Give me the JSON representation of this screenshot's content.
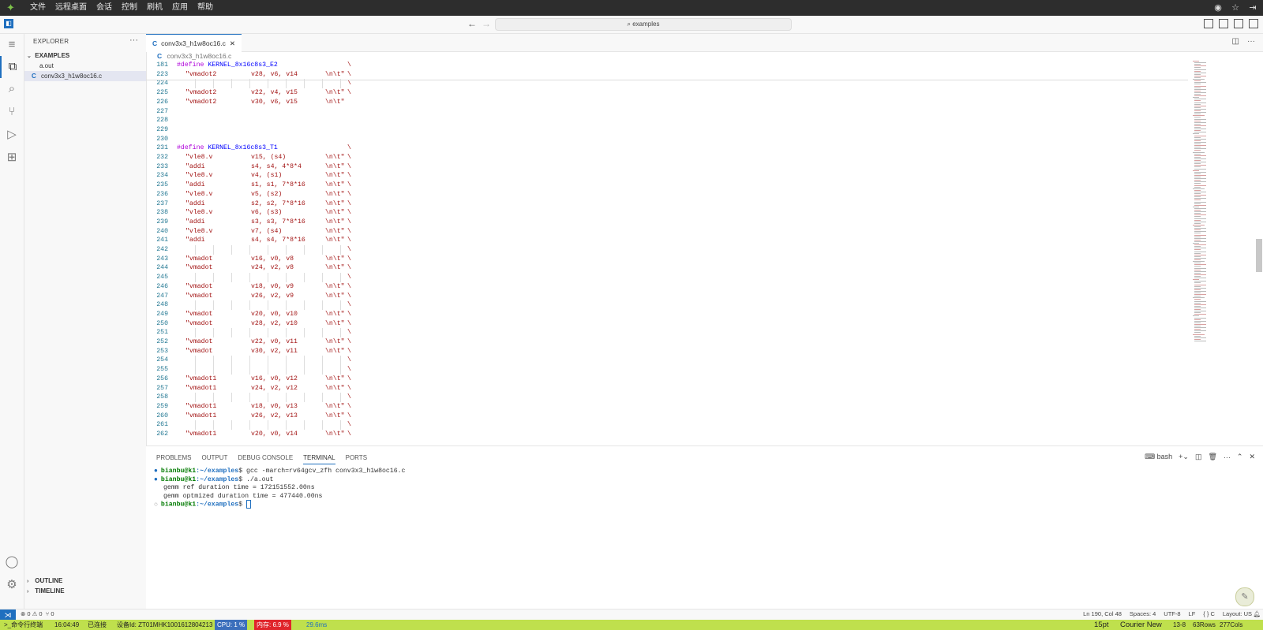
{
  "appbar": {
    "menu": [
      "文件",
      "远程桌面",
      "会话",
      "控制",
      "刷机",
      "应用",
      "帮助"
    ]
  },
  "titlebar": {
    "search": "examples",
    "back_icon": "arrow-left-icon",
    "forward_icon": "arrow-right-icon"
  },
  "sidebar": {
    "title": "EXPLORER",
    "folder": "EXAMPLES",
    "files": [
      {
        "name": "a.out",
        "icon": ""
      },
      {
        "name": "conv3x3_h1w8oc16.c",
        "icon": "C"
      }
    ],
    "outline": "OUTLINE",
    "timeline": "TIMELINE"
  },
  "editor": {
    "tab_icon": "C",
    "tab_label": "conv3x3_h1w8oc16.c",
    "breadcrumb": "conv3x3_h1w8oc16.c",
    "lines": [
      {
        "n": "181",
        "ind": "",
        "kind": "define",
        "a": "#define",
        "b": "KERNEL_8x16c8s3_E2",
        "c": "",
        "d": "\\"
      },
      {
        "n": "223",
        "ind": "  ",
        "kind": "insn",
        "a": "\"vmadot2",
        "b": "v28, v6, v14",
        "c": "\\n\\t\"",
        "d": "\\"
      },
      {
        "n": "224",
        "ind": "",
        "kind": "blank",
        "a": "",
        "b": "",
        "c": "",
        "d": "\\"
      },
      {
        "n": "225",
        "ind": "  ",
        "kind": "insn",
        "a": "\"vmadot2",
        "b": "v22, v4, v15",
        "c": "\\n\\t\"",
        "d": "\\"
      },
      {
        "n": "226",
        "ind": "  ",
        "kind": "insn",
        "a": "\"vmadot2",
        "b": "v30, v6, v15",
        "c": "\\n\\t\"",
        "d": ""
      },
      {
        "n": "227",
        "ind": "",
        "kind": "empty",
        "a": "",
        "b": "",
        "c": "",
        "d": ""
      },
      {
        "n": "228",
        "ind": "",
        "kind": "empty",
        "a": "",
        "b": "",
        "c": "",
        "d": ""
      },
      {
        "n": "229",
        "ind": "",
        "kind": "empty",
        "a": "",
        "b": "",
        "c": "",
        "d": ""
      },
      {
        "n": "230",
        "ind": "",
        "kind": "empty",
        "a": "",
        "b": "",
        "c": "",
        "d": ""
      },
      {
        "n": "231",
        "ind": "",
        "kind": "define",
        "a": "#define",
        "b": "KERNEL_8x16c8s3_T1",
        "c": "",
        "d": "\\"
      },
      {
        "n": "232",
        "ind": "  ",
        "kind": "insn",
        "a": "\"vle8.v",
        "b": "v15, (s4)",
        "c": "\\n\\t\"",
        "d": "\\"
      },
      {
        "n": "233",
        "ind": "  ",
        "kind": "insn",
        "a": "\"addi",
        "b": "s4, s4, 4*8*4",
        "c": "\\n\\t\"",
        "d": "\\"
      },
      {
        "n": "234",
        "ind": "  ",
        "kind": "insn",
        "a": "\"vle8.v",
        "b": "v4, (s1)",
        "c": "\\n\\t\"",
        "d": "\\"
      },
      {
        "n": "235",
        "ind": "  ",
        "kind": "insn",
        "a": "\"addi",
        "b": "s1, s1, 7*8*16",
        "c": "\\n\\t\"",
        "d": "\\"
      },
      {
        "n": "236",
        "ind": "  ",
        "kind": "insn",
        "a": "\"vle8.v",
        "b": "v5, (s2)",
        "c": "\\n\\t\"",
        "d": "\\"
      },
      {
        "n": "237",
        "ind": "  ",
        "kind": "insn",
        "a": "\"addi",
        "b": "s2, s2, 7*8*16",
        "c": "\\n\\t\"",
        "d": "\\"
      },
      {
        "n": "238",
        "ind": "  ",
        "kind": "insn",
        "a": "\"vle8.v",
        "b": "v6, (s3)",
        "c": "\\n\\t\"",
        "d": "\\"
      },
      {
        "n": "239",
        "ind": "  ",
        "kind": "insn",
        "a": "\"addi",
        "b": "s3, s3, 7*8*16",
        "c": "\\n\\t\"",
        "d": "\\"
      },
      {
        "n": "240",
        "ind": "  ",
        "kind": "insn",
        "a": "\"vle8.v",
        "b": "v7, (s4)",
        "c": "\\n\\t\"",
        "d": "\\"
      },
      {
        "n": "241",
        "ind": "  ",
        "kind": "insn",
        "a": "\"addi",
        "b": "s4, s4, 7*8*16",
        "c": "\\n\\t\"",
        "d": "\\"
      },
      {
        "n": "242",
        "ind": "",
        "kind": "blank",
        "a": "",
        "b": "",
        "c": "",
        "d": "\\"
      },
      {
        "n": "243",
        "ind": "  ",
        "kind": "insn",
        "a": "\"vmadot",
        "b": "v16, v0, v8",
        "c": "\\n\\t\"",
        "d": "\\"
      },
      {
        "n": "244",
        "ind": "  ",
        "kind": "insn",
        "a": "\"vmadot",
        "b": "v24, v2, v8",
        "c": "\\n\\t\"",
        "d": "\\"
      },
      {
        "n": "245",
        "ind": "",
        "kind": "blank",
        "a": "",
        "b": "",
        "c": "",
        "d": "\\"
      },
      {
        "n": "246",
        "ind": "  ",
        "kind": "insn",
        "a": "\"vmadot",
        "b": "v18, v0, v9",
        "c": "\\n\\t\"",
        "d": "\\"
      },
      {
        "n": "247",
        "ind": "  ",
        "kind": "insn",
        "a": "\"vmadot",
        "b": "v26, v2, v9",
        "c": "\\n\\t\"",
        "d": "\\"
      },
      {
        "n": "248",
        "ind": "",
        "kind": "blank",
        "a": "",
        "b": "",
        "c": "",
        "d": "\\"
      },
      {
        "n": "249",
        "ind": "  ",
        "kind": "insn",
        "a": "\"vmadot",
        "b": "v20, v0, v10",
        "c": "\\n\\t\"",
        "d": "\\"
      },
      {
        "n": "250",
        "ind": "  ",
        "kind": "insn",
        "a": "\"vmadot",
        "b": "v28, v2, v10",
        "c": "\\n\\t\"",
        "d": "\\"
      },
      {
        "n": "251",
        "ind": "",
        "kind": "blank",
        "a": "",
        "b": "",
        "c": "",
        "d": "\\"
      },
      {
        "n": "252",
        "ind": "  ",
        "kind": "insn",
        "a": "\"vmadot",
        "b": "v22, v0, v11",
        "c": "\\n\\t\"",
        "d": "\\"
      },
      {
        "n": "253",
        "ind": "  ",
        "kind": "insn",
        "a": "\"vmadot",
        "b": "v30, v2, v11",
        "c": "\\n\\t\"",
        "d": "\\"
      },
      {
        "n": "254",
        "ind": "",
        "kind": "blank",
        "a": "",
        "b": "",
        "c": "",
        "d": "\\"
      },
      {
        "n": "255",
        "ind": "",
        "kind": "blank",
        "a": "",
        "b": "",
        "c": "",
        "d": "\\"
      },
      {
        "n": "256",
        "ind": "  ",
        "kind": "insn",
        "a": "\"vmadot1",
        "b": "v16, v0, v12",
        "c": "\\n\\t\"",
        "d": "\\"
      },
      {
        "n": "257",
        "ind": "  ",
        "kind": "insn",
        "a": "\"vmadot1",
        "b": "v24, v2, v12",
        "c": "\\n\\t\"",
        "d": "\\"
      },
      {
        "n": "258",
        "ind": "",
        "kind": "blank",
        "a": "",
        "b": "",
        "c": "",
        "d": "\\"
      },
      {
        "n": "259",
        "ind": "  ",
        "kind": "insn",
        "a": "\"vmadot1",
        "b": "v18, v0, v13",
        "c": "\\n\\t\"",
        "d": "\\"
      },
      {
        "n": "260",
        "ind": "  ",
        "kind": "insn",
        "a": "\"vmadot1",
        "b": "v26, v2, v13",
        "c": "\\n\\t\"",
        "d": "\\"
      },
      {
        "n": "261",
        "ind": "",
        "kind": "blank",
        "a": "",
        "b": "",
        "c": "",
        "d": "\\"
      },
      {
        "n": "262",
        "ind": "  ",
        "kind": "insn",
        "a": "\"vmadot1",
        "b": "v20, v0, v14",
        "c": "\\n\\t\"",
        "d": "\\"
      }
    ]
  },
  "panel": {
    "tabs": [
      "PROBLEMS",
      "OUTPUT",
      "DEBUG CONSOLE",
      "TERMINAL",
      "PORTS"
    ],
    "active_tab": "TERMINAL",
    "shell": "bash",
    "terminal": [
      {
        "dot": "●",
        "user": "bianbu@k1",
        "path": ":~/examples",
        "cmd": "$ gcc -march=rv64gcv_zfh conv3x3_h1w8oc16.c"
      },
      {
        "dot": "●",
        "user": "bianbu@k1",
        "path": ":~/examples",
        "cmd": "$ ./a.out"
      },
      {
        "dot": "",
        "user": "",
        "path": "",
        "cmd": "gemm ref duration time = 172151552.00ns"
      },
      {
        "dot": "",
        "user": "",
        "path": "",
        "cmd": "gemm optmized duration time = 477440.00ns"
      },
      {
        "dot": "○",
        "user": "bianbu@k1",
        "path": ":~/examples",
        "cmd": "$ "
      }
    ]
  },
  "statusbar": {
    "errors": "⊗ 0 ⚠ 0",
    "ports": "⑂ 0",
    "position": "Ln 190, Col 48",
    "spaces": "Spaces: 4",
    "encoding": "UTF-8",
    "eol": "LF",
    "language": "{ } C",
    "layout": "Layout: US"
  },
  "hostbar": {
    "terminal": ">_命令行终端",
    "time": "16:04:49",
    "connected": "已连接",
    "device": "设备Id: ZT01MHK1001612804213",
    "cpu": "CPU: 1 %",
    "mem": "内存: 6.9 %",
    "latency": "29.6ms",
    "font_size": "15pt",
    "font_name": "Courier New",
    "cursor": "13-8",
    "rows": "63Rows",
    "cols": "277Cols"
  },
  "colors": {
    "accent": "#1f6fbf",
    "hostbar": "#bfe04d",
    "cpu": "#3c6fbc",
    "mem": "#e0252b"
  }
}
